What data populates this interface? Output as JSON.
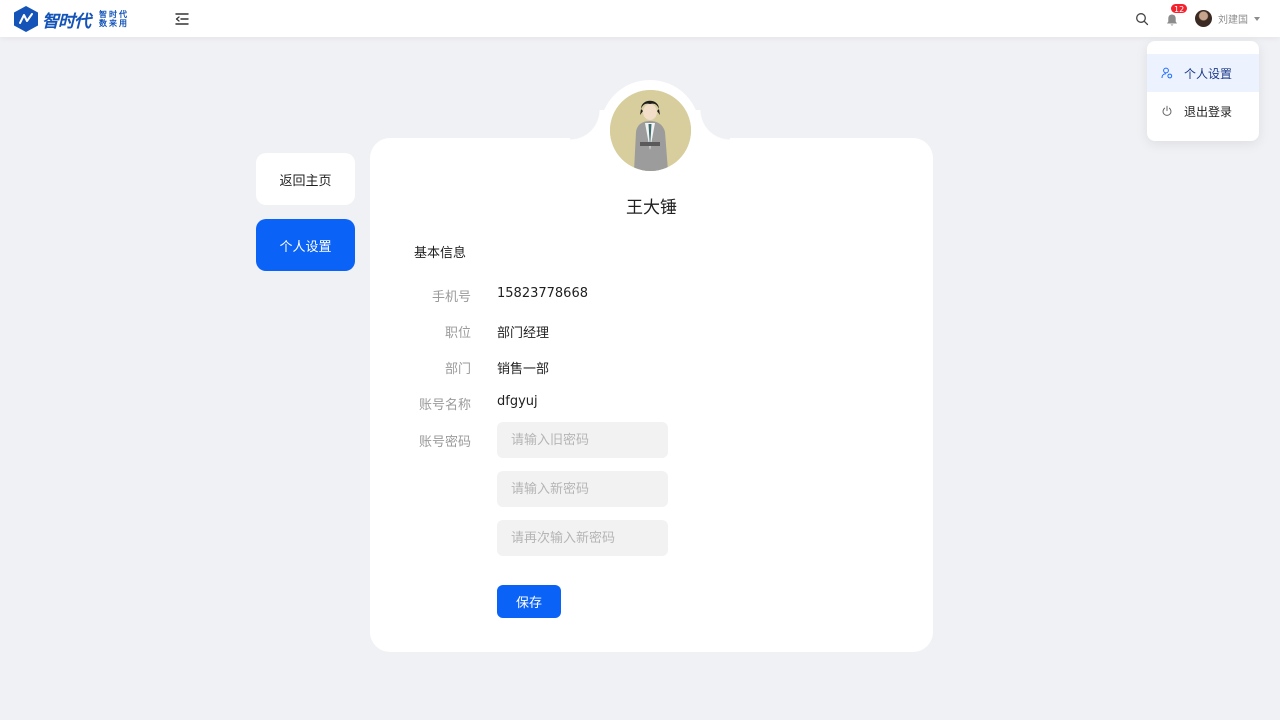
{
  "header": {
    "logo_text": "智时代",
    "logo_sub": "智时代数来用",
    "user_name": "刘建国",
    "notification_count": "12"
  },
  "dropdown": {
    "items": [
      {
        "label": "个人设置",
        "icon": "user-settings-icon",
        "active": true
      },
      {
        "label": "退出登录",
        "icon": "power-icon",
        "active": false
      }
    ]
  },
  "sidebar": {
    "back_label": "返回主页",
    "settings_label": "个人设置"
  },
  "profile": {
    "name": "王大锤",
    "section_title": "基本信息",
    "fields": [
      {
        "label": "手机号",
        "value": "15823778668"
      },
      {
        "label": "职位",
        "value": "部门经理"
      },
      {
        "label": "部门",
        "value": "销售一部"
      },
      {
        "label": "账号名称",
        "value": "dfgyuj"
      }
    ],
    "password_label": "账号密码",
    "old_password_placeholder": "请输入旧密码",
    "new_password_placeholder": "请输入新密码",
    "confirm_password_placeholder": "请再次输入新密码",
    "save_label": "保存"
  },
  "colors": {
    "primary": "#0b62f6",
    "brand": "#1454b8",
    "background": "#f0f1f5",
    "badge": "#f5222d"
  }
}
